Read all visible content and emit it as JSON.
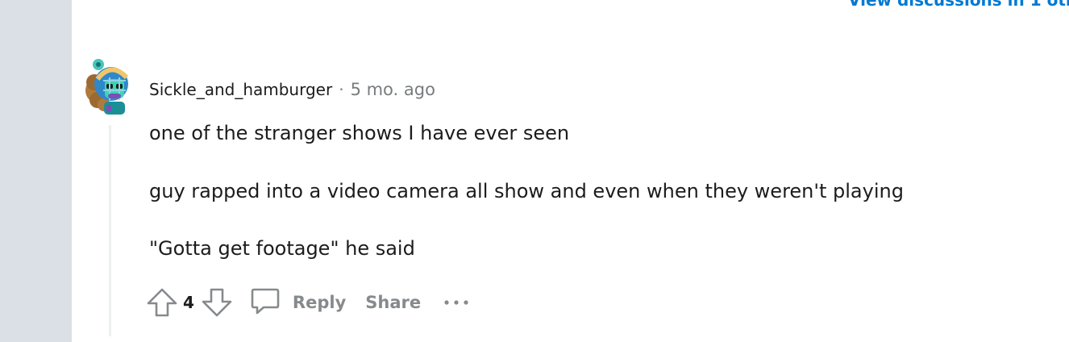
{
  "header": {
    "view_discussions_link": "View discussions in 1 oth"
  },
  "comment": {
    "username": "Sickle_and_hamburger",
    "separator": "·",
    "timestamp": "5 mo. ago",
    "paragraphs": [
      "one of the stranger shows I have ever seen",
      "guy rapped into a video camera all show and even when they weren't playing",
      "\"Gotta get footage\" he said"
    ],
    "vote_count": "4",
    "reply_label": "Reply",
    "share_label": "Share",
    "more_label": "···"
  },
  "colors": {
    "link_blue": "#0079d3",
    "gutter": "#dae0e6",
    "muted_text": "#878a8c",
    "meta_text": "#787c7e"
  },
  "icons": {
    "upvote": "arrow-up-outline",
    "downvote": "arrow-down-outline",
    "reply": "speech-bubble-outline",
    "more": "horizontal-ellipsis"
  }
}
